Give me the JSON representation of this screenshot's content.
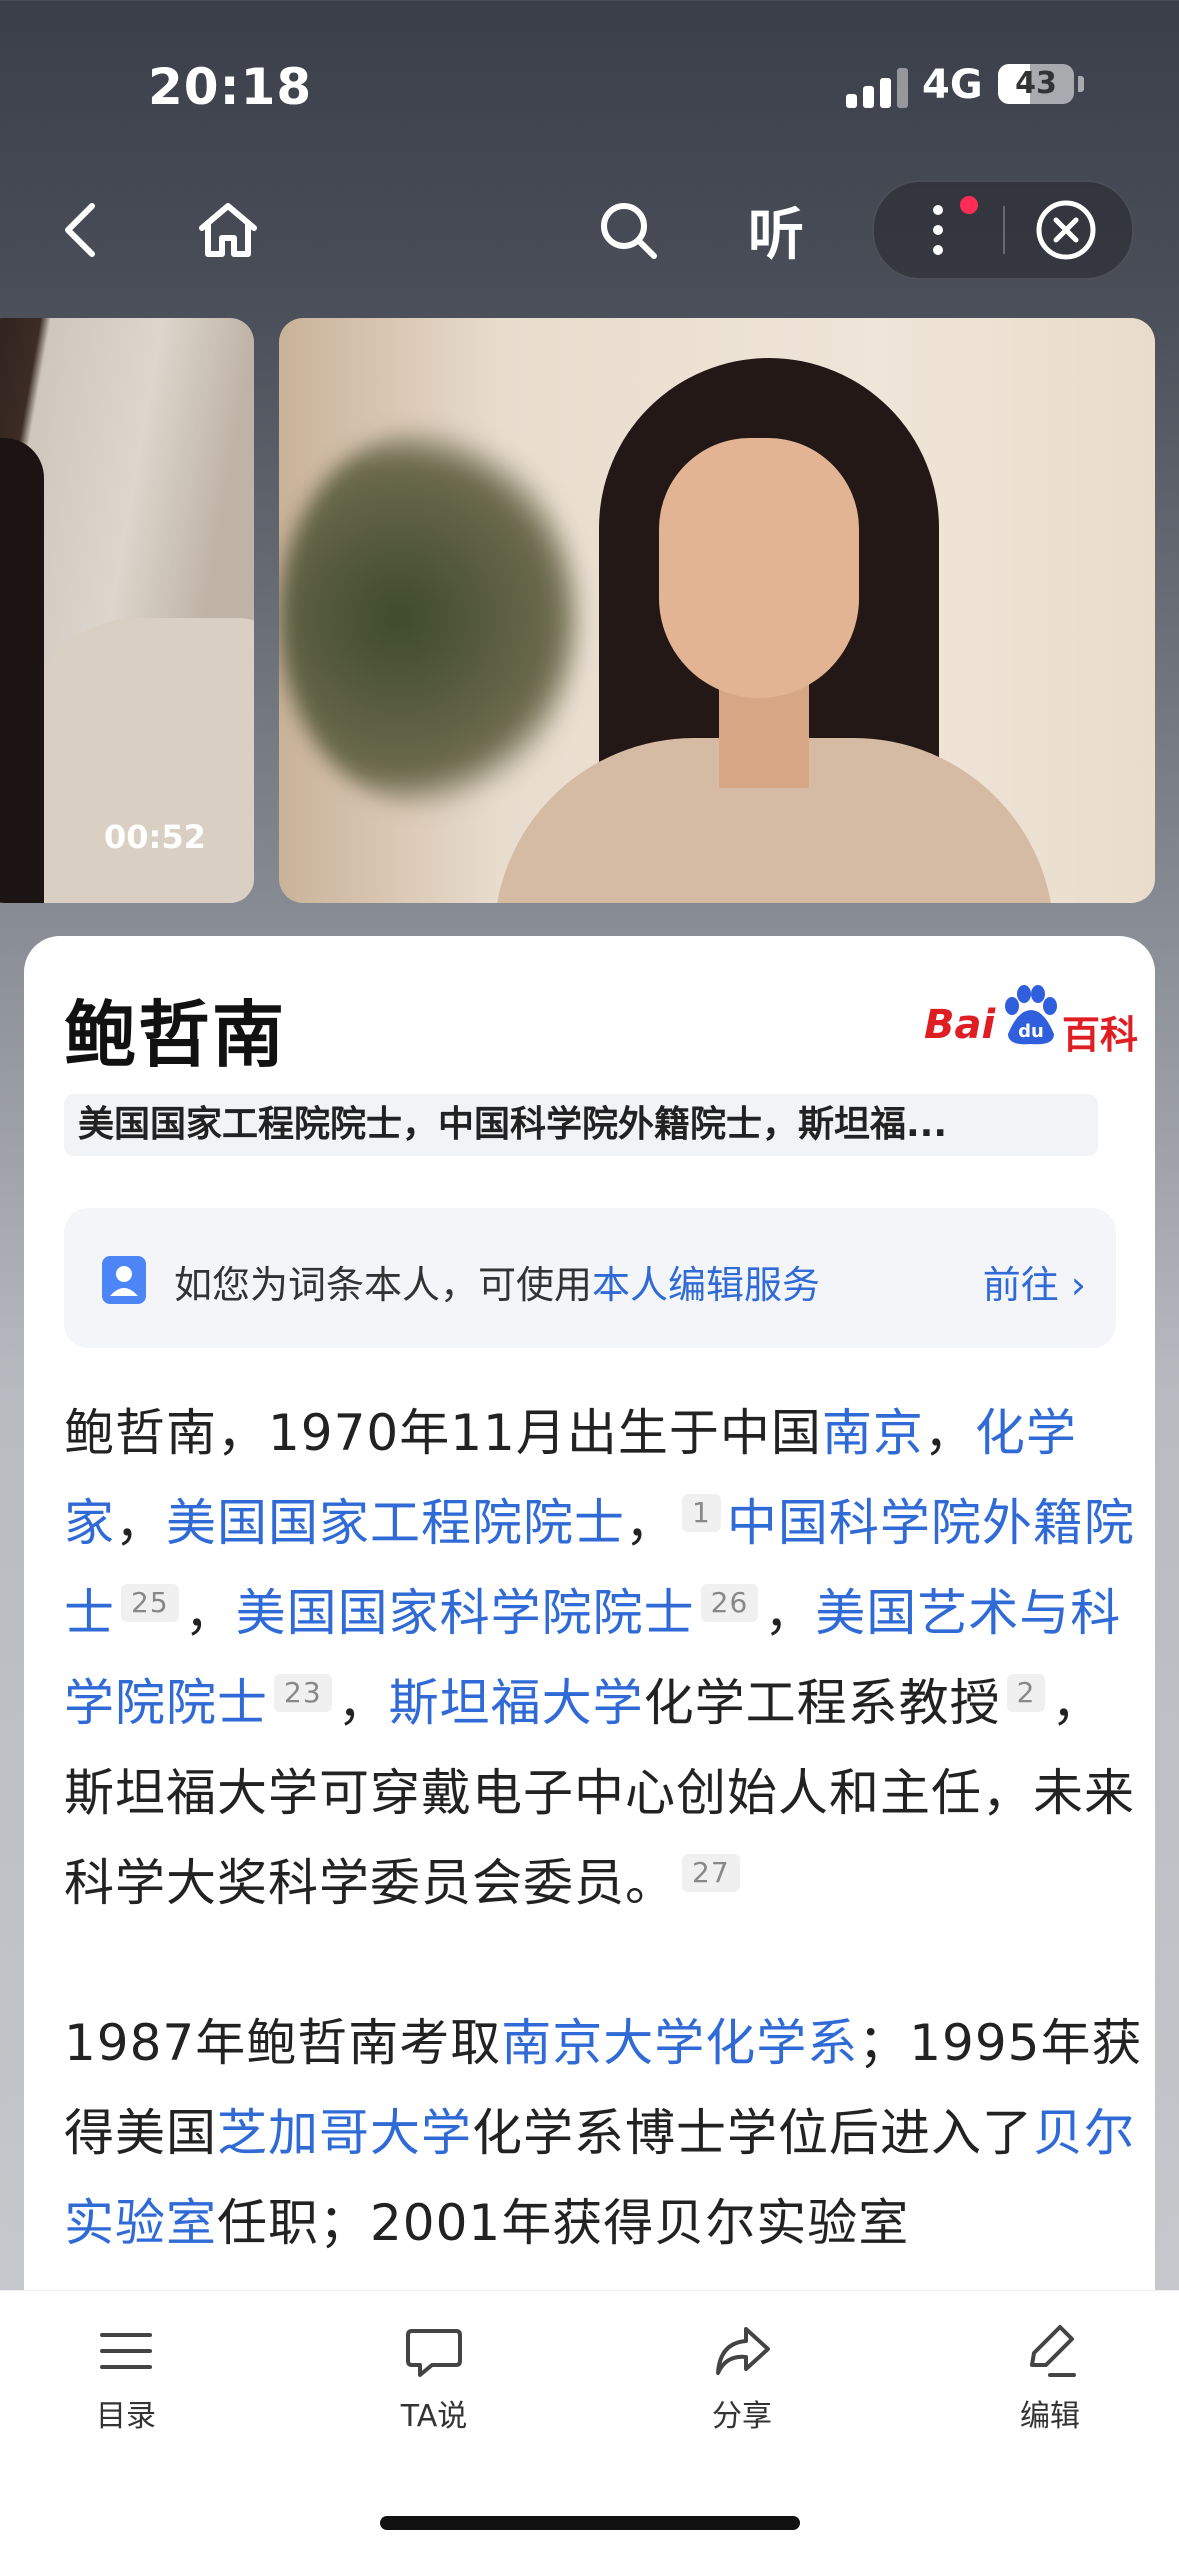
{
  "status": {
    "time": "20:18",
    "network": "4G",
    "battery": "43"
  },
  "nav": {
    "listen_label": "听"
  },
  "gallery": {
    "video_duration": "00:52"
  },
  "entry": {
    "title": "鲍哲南",
    "source_logo_text_latin": "Bai",
    "source_logo_text_paw": "du",
    "source_logo_text_cn": "百科",
    "subtitle": "美国国家工程院院士，中国科学院外籍院士，斯坦福..."
  },
  "notice": {
    "prefix": "如您为词条本人，可使用",
    "link": "本人编辑服务",
    "action": "前往 ›"
  },
  "para1": {
    "t1": "鲍哲南，1970年11月出生于中国",
    "l1": "南京",
    "t2": "，",
    "l2": "化学家",
    "t3": "，",
    "l3": "美国国家工程院院士",
    "t4": "，",
    "r1": "1",
    "l4": "中国科学院外籍院士",
    "r2": "25",
    "t5": "，",
    "l5": "美国国家科学院院士",
    "r3": "26",
    "t6": "，",
    "l6": "美国艺术与科学院院士",
    "r4": "23",
    "t7": "，",
    "l7": "斯坦福大学",
    "t8": "化学工程系教授",
    "r5": "2",
    "t9": "，斯坦福大学可穿戴电子中心创始人和主任，未来科学大奖科学委员会委员。",
    "r6": "27"
  },
  "para2": {
    "t1": "1987年鲍哲南考取",
    "l1": "南京大学化学系",
    "t2": "；1995年获得美国",
    "l2": "芝加哥大学",
    "t3": "化学系博士学位后进入了",
    "l3": "贝尔实验室",
    "t4": "任职；2001年获得贝尔实验室"
  },
  "tabbar": {
    "items": [
      {
        "label": "目录",
        "icon": "menu-list-icon"
      },
      {
        "label": "TA说",
        "icon": "chat-bubble-icon"
      },
      {
        "label": "分享",
        "icon": "share-arrow-icon"
      },
      {
        "label": "编辑",
        "icon": "edit-pencil-icon"
      }
    ]
  }
}
